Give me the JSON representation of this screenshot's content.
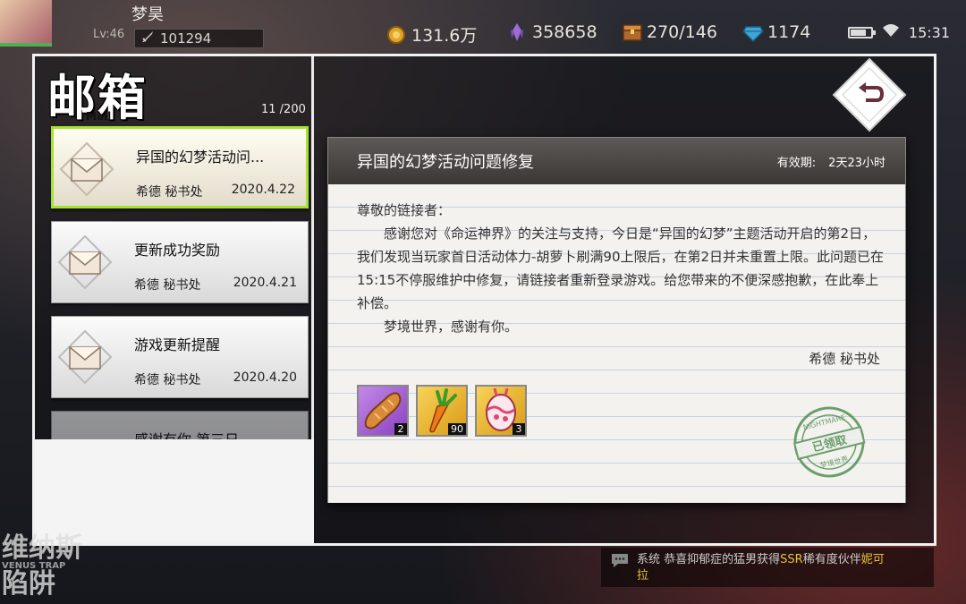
{
  "player": {
    "name": "梦昊",
    "level": "Lv:46",
    "power": "101294"
  },
  "resources": [
    {
      "icon": "gold-coin-icon",
      "value": "131.6万"
    },
    {
      "icon": "purple-crystal-icon",
      "value": "358658"
    },
    {
      "icon": "stamina-chest-icon",
      "value": "270/146"
    },
    {
      "icon": "diamond-icon",
      "value": "1174"
    }
  ],
  "status": {
    "time": "15:31"
  },
  "mailbox": {
    "title": "邮箱",
    "subtitle": "Mail",
    "count": "11  /200",
    "items": [
      {
        "title": "异国的幻梦活动问...",
        "sender": "希德 秘书处",
        "date": "2020.4.22"
      },
      {
        "title": "更新成功奖励",
        "sender": "希德 秘书处",
        "date": "2020.4.21"
      },
      {
        "title": "游戏更新提醒",
        "sender": "希德 秘书处",
        "date": "2020.4.20"
      },
      {
        "title": "感谢有你 第三日",
        "sender": "",
        "date": ""
      }
    ]
  },
  "letter": {
    "title": "异国的幻梦活动问题修复",
    "validity_label": "有效期:",
    "validity_value": "2天23小时",
    "greeting": "尊敬的链接者：",
    "paragraph1": "感谢您对《命运神界》的关注与支持，今日是“异国的幻梦”主题活动开启的第2日，我们发现当玩家首日活动体力-胡萝卜刷满90上限后，在第2日并未重置上限。此问题已在15:15不停服维护中修复，请链接者重新登录游戏。给您带来的不便深感抱歉，在此奉上补偿。",
    "paragraph2": "梦境世界，感谢有你。",
    "signature": "希德 秘书处",
    "rewards": [
      {
        "icon": "bread-icon",
        "quantity": "2",
        "color": "#a25ad0"
      },
      {
        "icon": "carrot-icon",
        "quantity": "90",
        "color": "#e9b324"
      },
      {
        "icon": "easter-egg-icon",
        "quantity": "3",
        "color": "#e9b324"
      }
    ],
    "stamp": {
      "top": "NIGHTMARE",
      "main": "已领取",
      "bottom": "梦境世界"
    }
  },
  "chat": {
    "system": "系统",
    "text_before": "恭喜抑郁症的猛男获得",
    "ssr": "SSR",
    "text_after": "稀有度伙伴",
    "name_part1": "妮可",
    "name_part2": "拉"
  },
  "decor": {
    "line1": "维纳斯",
    "line2": "陷阱",
    "small": "VENUS TRAP"
  }
}
